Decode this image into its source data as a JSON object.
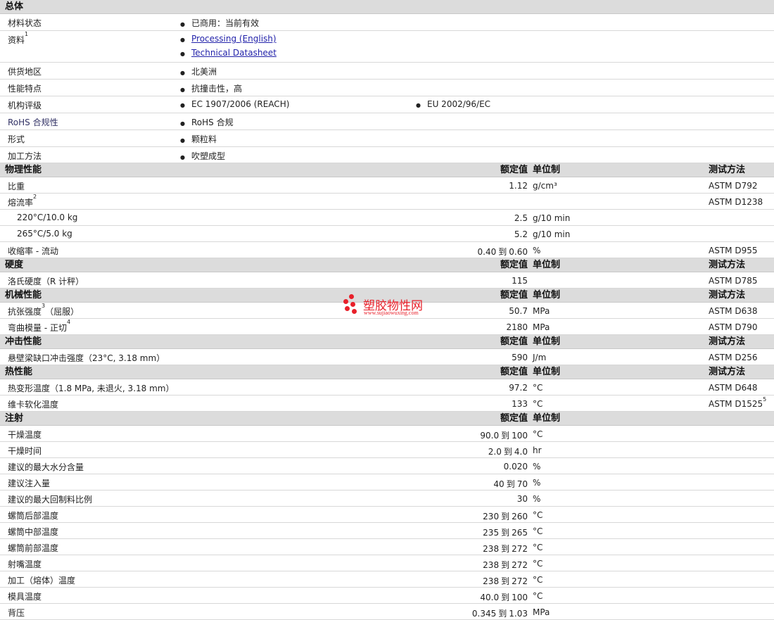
{
  "general": {
    "title": "总体",
    "rows": [
      {
        "label": "材料状态",
        "items": [
          "已商用：当前有效"
        ]
      },
      {
        "label": "资料",
        "sup": "1",
        "links": [
          "Processing (English)",
          "Technical Datasheet"
        ]
      },
      {
        "label": "供货地区",
        "items": [
          "北美洲"
        ]
      },
      {
        "label": "性能特点",
        "items": [
          "抗撞击性，高"
        ]
      },
      {
        "label": "机构评级",
        "items": [
          "EC 1907/2006 (REACH)"
        ],
        "items2": [
          "EU 2002/96/EC"
        ]
      },
      {
        "label": "RoHS 合规性",
        "items": [
          "RoHS 合规"
        ]
      },
      {
        "label": "形式",
        "items": [
          "颗粒料"
        ]
      },
      {
        "label": "加工方法",
        "items": [
          "吹塑成型"
        ]
      }
    ]
  },
  "headers": {
    "nominal": "额定值",
    "unit": "单位制",
    "test": "测试方法"
  },
  "to_word": "到",
  "sections": [
    {
      "title": "物理性能",
      "show_test": true,
      "rows": [
        {
          "label": "比重",
          "value": "1.12",
          "unit": "g/cm³",
          "test": "ASTM D792"
        },
        {
          "label": "熔流率",
          "sup": "2",
          "value": "",
          "unit": "",
          "test": "ASTM D1238"
        },
        {
          "label": "220°C/10.0 kg",
          "sub": true,
          "value": "2.5",
          "unit": "g/10 min",
          "test": ""
        },
        {
          "label": "265°C/5.0 kg",
          "sub": true,
          "value": "5.2",
          "unit": "g/10 min",
          "test": ""
        },
        {
          "label": "收缩率 - 流动",
          "value": "0.40",
          "value2": "0.60",
          "unit": "%",
          "test": "ASTM D955"
        }
      ]
    },
    {
      "title": "硬度",
      "show_test": true,
      "rows": [
        {
          "label": "洛氏硬度（R 计秤）",
          "value": "115",
          "unit": "",
          "test": "ASTM D785"
        }
      ]
    },
    {
      "title": "机械性能",
      "show_test": true,
      "rows": [
        {
          "label": "抗张强度",
          "sup": "3",
          "label_suffix": "（屈服）",
          "value": "50.7",
          "unit": "MPa",
          "test": "ASTM D638"
        },
        {
          "label": "弯曲模量 - 正切",
          "sup": "4",
          "value": "2180",
          "unit": "MPa",
          "test": "ASTM D790"
        }
      ]
    },
    {
      "title": "冲击性能",
      "show_test": true,
      "rows": [
        {
          "label": "悬壁梁缺口冲击强度（23°C, 3.18 mm）",
          "value": "590",
          "unit": "J/m",
          "test": "ASTM D256"
        }
      ]
    },
    {
      "title": "热性能",
      "show_test": true,
      "rows": [
        {
          "label": "热变形温度（1.8 MPa, 未退火, 3.18 mm）",
          "value": "97.2",
          "unit": "°C",
          "test": "ASTM D648"
        },
        {
          "label": "维卡软化温度",
          "value": "133",
          "unit": "°C",
          "test": "ASTM D1525",
          "test_sup": "5"
        }
      ]
    },
    {
      "title": "注射",
      "show_test": false,
      "rows": [
        {
          "label": "干燥温度",
          "value": "90.0",
          "value2": "100",
          "unit": "°C"
        },
        {
          "label": "干燥时间",
          "value": "2.0",
          "value2": "4.0",
          "unit": "hr"
        },
        {
          "label": "建议的最大水分含量",
          "value": "0.020",
          "unit": "%"
        },
        {
          "label": "建议注入量",
          "value": "40",
          "value2": "70",
          "unit": "%"
        },
        {
          "label": "建议的最大回制料比例",
          "value": "30",
          "unit": "%"
        },
        {
          "label": "螺筒后部温度",
          "value": "230",
          "value2": "260",
          "unit": "°C"
        },
        {
          "label": "螺筒中部温度",
          "value": "235",
          "value2": "265",
          "unit": "°C"
        },
        {
          "label": "螺筒前部温度",
          "value": "238",
          "value2": "272",
          "unit": "°C"
        },
        {
          "label": "射嘴温度",
          "value": "238",
          "value2": "272",
          "unit": "°C"
        },
        {
          "label": "加工（熔体）温度",
          "value": "238",
          "value2": "272",
          "unit": "°C"
        },
        {
          "label": "模具温度",
          "value": "40.0",
          "value2": "100",
          "unit": "°C"
        },
        {
          "label": "背压",
          "value": "0.345",
          "value2": "1.03",
          "unit": "MPa"
        }
      ]
    }
  ],
  "watermark": {
    "name": "塑胶物性网",
    "url": "www.sujiaowuxing.com",
    "color": "#e8202a"
  }
}
